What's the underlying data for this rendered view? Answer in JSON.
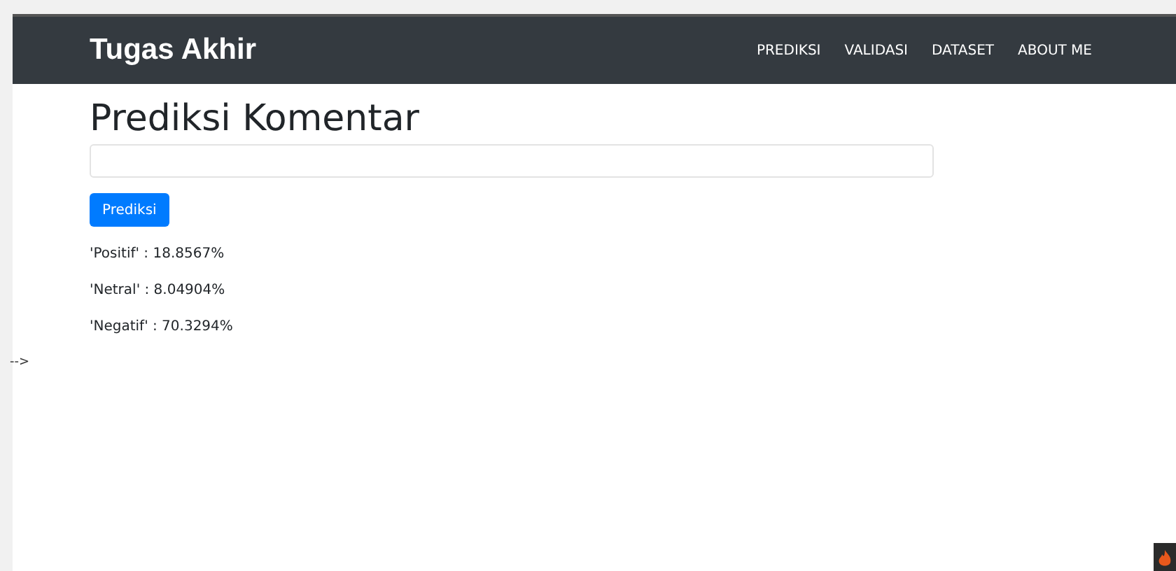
{
  "navbar": {
    "brand": "Tugas Akhir",
    "links": [
      {
        "label": "PREDIKSI"
      },
      {
        "label": "VALIDASI"
      },
      {
        "label": "DATASET"
      },
      {
        "label": "ABOUT ME"
      }
    ]
  },
  "heading": "Prediksi Komentar",
  "predict_button": "Prediksi",
  "results": [
    "'Positif' : 18.8567%",
    "'Netral' : 8.04904%",
    "'Negatif' : 70.3294%"
  ],
  "stray_text": "-->"
}
